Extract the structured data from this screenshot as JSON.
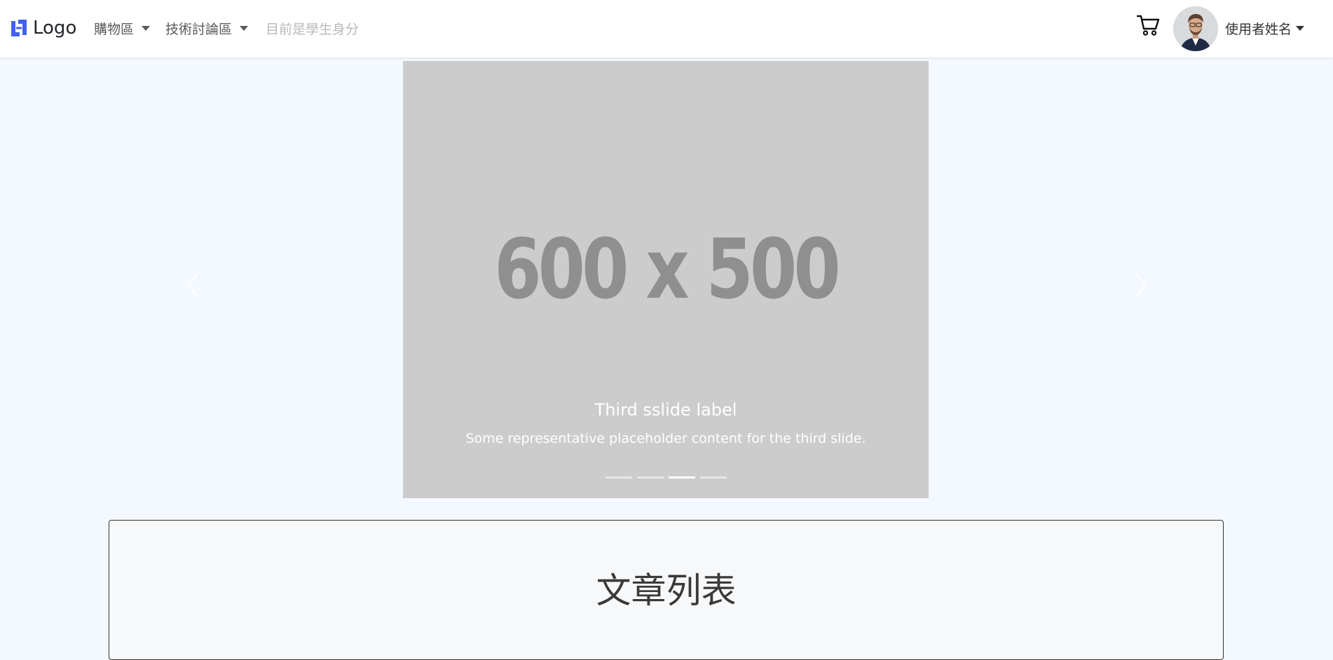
{
  "navbar": {
    "brand": {
      "label": "Logo",
      "icon": "logo-icon",
      "color": "#4361ee"
    },
    "menus": [
      {
        "label": "購物區"
      },
      {
        "label": "技術討論區"
      }
    ],
    "status_text": "目前是學生身分",
    "cart_icon": "cart-icon",
    "user": {
      "name": "使用者姓名",
      "avatar": "user-avatar"
    }
  },
  "carousel": {
    "placeholder": "600 x 500",
    "title": "Third sslide label",
    "caption": "Some representative placeholder content for the third slide.",
    "indicator_count": 4,
    "active_index": 2,
    "prev_icon": "chevron-left-icon",
    "next_icon": "chevron-right-icon"
  },
  "article_section": {
    "title": "文章列表"
  }
}
